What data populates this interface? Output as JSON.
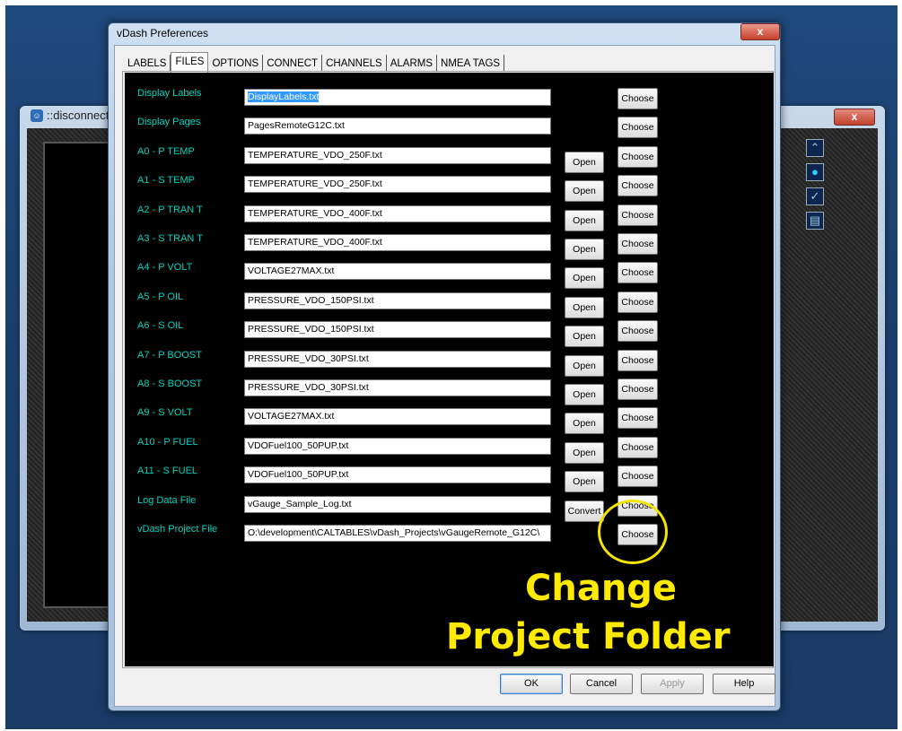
{
  "background_window": {
    "title": "::disconnected",
    "close_label": "x",
    "side_buttons": [
      "chart-icon",
      "circle-icon",
      "check-icon",
      "document-icon"
    ]
  },
  "dialog": {
    "title": "vDash Preferences",
    "close_label": "x",
    "tabs": [
      {
        "label": "LABELS",
        "active": false
      },
      {
        "label": "FILES",
        "active": true
      },
      {
        "label": "OPTIONS",
        "active": false
      },
      {
        "label": "CONNECT",
        "active": false
      },
      {
        "label": "CHANNELS",
        "active": false
      },
      {
        "label": "ALARMS",
        "active": false
      },
      {
        "label": "NMEA TAGS",
        "active": false
      }
    ],
    "rows": [
      {
        "label": "Display Labels",
        "value": "DisplayLabels.txt",
        "open": "",
        "choose": "Choose"
      },
      {
        "label": "Display Pages",
        "value": "PagesRemoteG12C.txt",
        "open": "",
        "choose": "Choose"
      },
      {
        "label": "A0 - P TEMP",
        "value": "TEMPERATURE_VDO_250F.txt",
        "open": "Open",
        "choose": "Choose"
      },
      {
        "label": "A1  - S TEMP",
        "value": "TEMPERATURE_VDO_250F.txt",
        "open": "Open",
        "choose": "Choose"
      },
      {
        "label": "A2  - P TRAN T",
        "value": "TEMPERATURE_VDO_400F.txt",
        "open": "Open",
        "choose": "Choose"
      },
      {
        "label": "A3 - S TRAN T",
        "value": "TEMPERATURE_VDO_400F.txt",
        "open": "Open",
        "choose": "Choose"
      },
      {
        "label": "A4  - P VOLT",
        "value": "VOLTAGE27MAX.txt",
        "open": "Open",
        "choose": "Choose"
      },
      {
        "label": "A5  - P OIL",
        "value": "PRESSURE_VDO_150PSI.txt",
        "open": "Open",
        "choose": "Choose"
      },
      {
        "label": "A6  - S OIL",
        "value": "PRESSURE_VDO_150PSI.txt",
        "open": "Open",
        "choose": "Choose"
      },
      {
        "label": "A7  - P BOOST",
        "value": "PRESSURE_VDO_30PSI.txt",
        "open": "Open",
        "choose": "Choose"
      },
      {
        "label": "A8  - S BOOST",
        "value": "PRESSURE_VDO_30PSI.txt",
        "open": "Open",
        "choose": "Choose"
      },
      {
        "label": "A9  - S VOLT",
        "value": "VOLTAGE27MAX.txt",
        "open": "Open",
        "choose": "Choose"
      },
      {
        "label": "A10  - P FUEL",
        "value": "VDOFuel100_50PUP.txt",
        "open": "Open",
        "choose": "Choose"
      },
      {
        "label": "A11 - S FUEL",
        "value": "VDOFuel100_50PUP.txt",
        "open": "Open",
        "choose": "Choose"
      },
      {
        "label": "Log Data File",
        "value": "vGauge_Sample_Log.txt",
        "open": "Convert",
        "choose": "Choose"
      },
      {
        "label": "vDash Project File",
        "value": "O:\\development\\CALTABLES\\vDash_Projects\\vGaugeRemote_G12C\\",
        "open": "",
        "choose": "Choose"
      }
    ],
    "buttons": {
      "ok": "OK",
      "cancel": "Cancel",
      "apply": "Apply",
      "help": "Help"
    }
  },
  "annotation": {
    "line1": "Change",
    "line2": "Project Folder",
    "color": "#ffea00"
  }
}
